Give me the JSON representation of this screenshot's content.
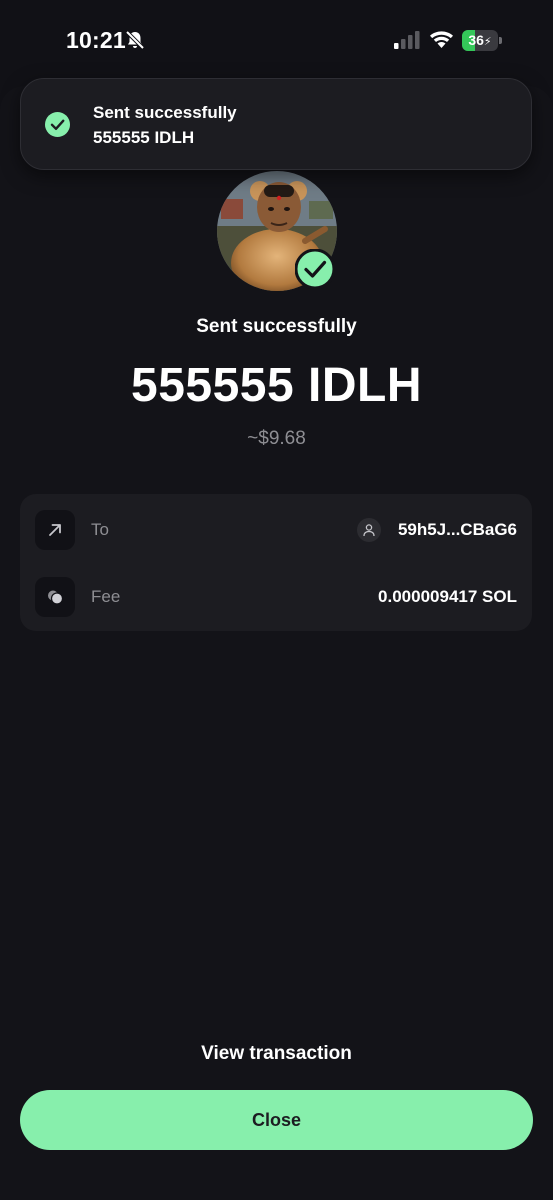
{
  "status_bar": {
    "time": "10:21",
    "battery_level": "36",
    "battery_fraction": 0.36,
    "icons": [
      "bell-off-icon",
      "signal-icon",
      "wifi-icon",
      "battery-charging-icon"
    ]
  },
  "toast": {
    "title": "Sent successfully",
    "subtitle": "555555 IDLH",
    "icon": "check-circle-icon"
  },
  "summary": {
    "headline": "Sent successfully",
    "amount": "555555 IDLH",
    "fiat": "~$9.68",
    "avatar_icon": "token-avatar",
    "badge_icon": "check-badge-icon"
  },
  "details": {
    "to": {
      "label": "To",
      "value": "59h5J...CBaG6",
      "icon": "arrow-up-right-icon",
      "value_icon": "person-icon"
    },
    "fee": {
      "label": "Fee",
      "value": "0.000009417 SOL",
      "icon": "coins-icon"
    }
  },
  "actions": {
    "view_transaction": "View transaction",
    "close": "Close"
  },
  "colors": {
    "background": "#111116",
    "card": "#1c1c21",
    "accent": "#87efac",
    "muted_text": "#8e8e93"
  }
}
